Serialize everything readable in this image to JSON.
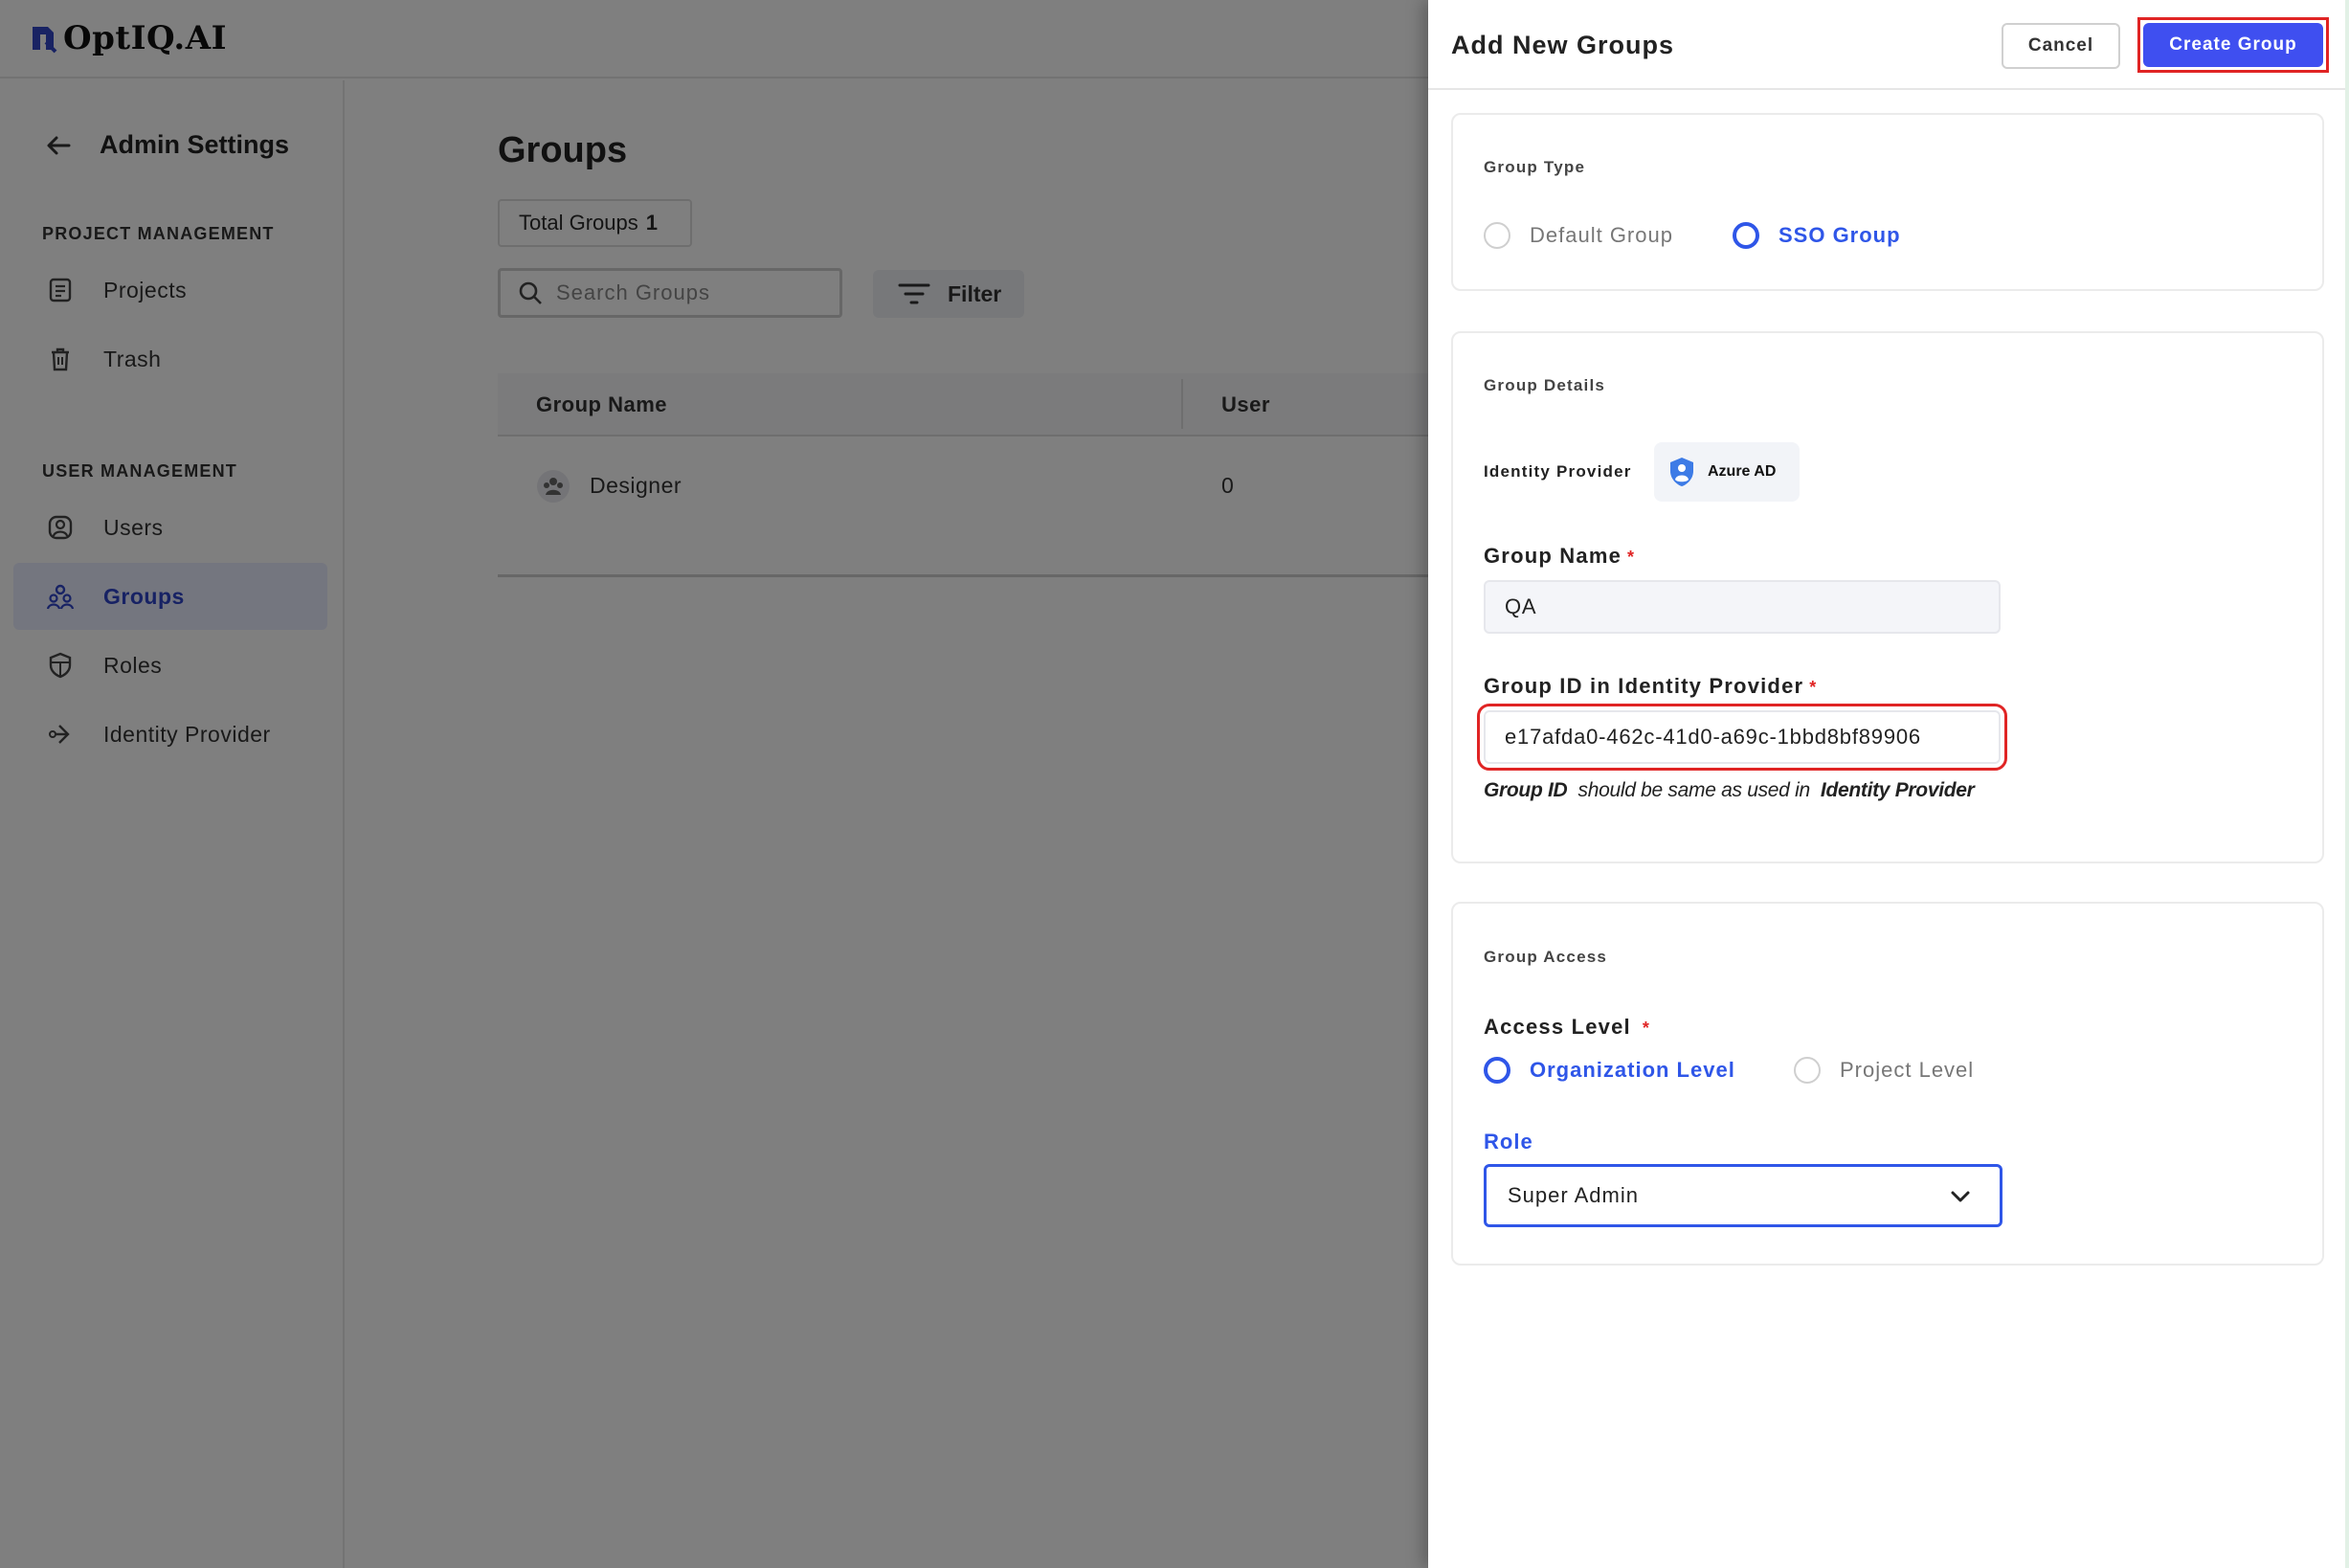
{
  "app": {
    "logo_text": "OptIQ.AI"
  },
  "sidebar": {
    "back_title": "Admin Settings",
    "sections": [
      {
        "title": "PROJECT MANAGEMENT",
        "items": [
          {
            "label": "Projects",
            "icon": "document-icon"
          },
          {
            "label": "Trash",
            "icon": "trash-icon"
          }
        ]
      },
      {
        "title": "USER MANAGEMENT",
        "items": [
          {
            "label": "Users",
            "icon": "user-icon"
          },
          {
            "label": "Groups",
            "icon": "groups-icon",
            "active": true
          },
          {
            "label": "Roles",
            "icon": "shield-icon"
          },
          {
            "label": "Identity Provider",
            "icon": "sign-in-icon"
          }
        ]
      }
    ]
  },
  "main": {
    "title": "Groups",
    "total_label": "Total Groups",
    "total_count": "1",
    "search_placeholder": "Search Groups",
    "filter_label": "Filter",
    "columns": [
      "Group Name",
      "User"
    ],
    "rows": [
      {
        "name": "Designer",
        "users": "0"
      }
    ]
  },
  "drawer": {
    "title": "Add New Groups",
    "cancel_label": "Cancel",
    "create_label": "Create Group",
    "group_type": {
      "title": "Group Type",
      "options": [
        {
          "label": "Default Group",
          "selected": false
        },
        {
          "label": "SSO Group",
          "selected": true
        }
      ]
    },
    "group_details": {
      "title": "Group Details",
      "identity_provider_label": "Identity Provider",
      "identity_provider_value": "Azure AD",
      "group_name_label": "Group Name",
      "group_name_value": "QA",
      "group_id_label": "Group ID in Identity Provider",
      "group_id_value": "e17afda0-462c-41d0-a69c-1bbd8bf89906",
      "hint_bold_1": "Group ID",
      "hint_text": "should be same as used in",
      "hint_bold_2": "Identity Provider",
      "required_mark": "*"
    },
    "group_access": {
      "title": "Group Access",
      "access_level_label": "Access Level",
      "options": [
        {
          "label": "Organization Level",
          "selected": true
        },
        {
          "label": "Project Level",
          "selected": false
        }
      ],
      "role_label": "Role",
      "role_value": "Super Admin"
    }
  },
  "colors": {
    "accent": "#3f4ff0",
    "highlight": "#e02424",
    "selected": "#2f56e8"
  }
}
